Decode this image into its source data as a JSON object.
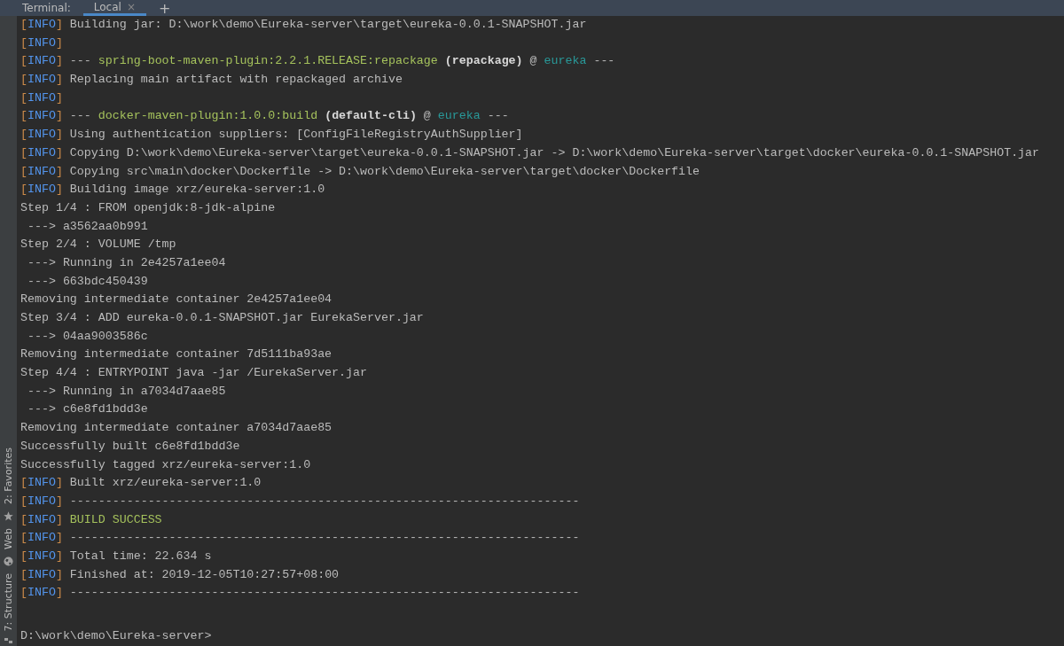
{
  "tool_window": {
    "title": "Terminal:",
    "tabs": [
      {
        "label": "Local",
        "close": "×",
        "selected": true
      }
    ],
    "add": "+"
  },
  "sidebar": {
    "items": [
      {
        "label": "2: Favorites",
        "kind": "star"
      },
      {
        "label": "Web",
        "kind": "globe"
      },
      {
        "label": "7: Structure",
        "kind": "structure"
      }
    ]
  },
  "console": {
    "lines": [
      {
        "segments": [
          {
            "kind": "bracket",
            "text": "["
          },
          {
            "kind": "level",
            "text": "INFO"
          },
          {
            "kind": "bracket",
            "text": "]"
          },
          {
            "kind": "plain",
            "text": " Building jar: D:\\work\\demo\\Eureka-server\\target\\eureka-0.0.1-SNAPSHOT.jar"
          }
        ]
      },
      {
        "segments": [
          {
            "kind": "bracket",
            "text": "["
          },
          {
            "kind": "level",
            "text": "INFO"
          },
          {
            "kind": "bracket",
            "text": "]"
          }
        ]
      },
      {
        "segments": [
          {
            "kind": "bracket",
            "text": "["
          },
          {
            "kind": "level",
            "text": "INFO"
          },
          {
            "kind": "bracket",
            "text": "]"
          },
          {
            "kind": "plain",
            "text": " --- "
          },
          {
            "kind": "plugin",
            "text": "spring-boot-maven-plugin:2.2.1.RELEASE:repackage"
          },
          {
            "kind": "bold",
            "text": " (repackage)"
          },
          {
            "kind": "plain",
            "text": " @ "
          },
          {
            "kind": "module",
            "text": "eureka"
          },
          {
            "kind": "plain",
            "text": " ---"
          }
        ]
      },
      {
        "segments": [
          {
            "kind": "bracket",
            "text": "["
          },
          {
            "kind": "level",
            "text": "INFO"
          },
          {
            "kind": "bracket",
            "text": "]"
          },
          {
            "kind": "plain",
            "text": " Replacing main artifact with repackaged archive"
          }
        ]
      },
      {
        "segments": [
          {
            "kind": "bracket",
            "text": "["
          },
          {
            "kind": "level",
            "text": "INFO"
          },
          {
            "kind": "bracket",
            "text": "]"
          }
        ]
      },
      {
        "segments": [
          {
            "kind": "bracket",
            "text": "["
          },
          {
            "kind": "level",
            "text": "INFO"
          },
          {
            "kind": "bracket",
            "text": "]"
          },
          {
            "kind": "plain",
            "text": " --- "
          },
          {
            "kind": "plugin",
            "text": "docker-maven-plugin:1.0.0:build"
          },
          {
            "kind": "bold",
            "text": " (default-cli)"
          },
          {
            "kind": "plain",
            "text": " @ "
          },
          {
            "kind": "module",
            "text": "eureka"
          },
          {
            "kind": "plain",
            "text": " ---"
          }
        ]
      },
      {
        "segments": [
          {
            "kind": "bracket",
            "text": "["
          },
          {
            "kind": "level",
            "text": "INFO"
          },
          {
            "kind": "bracket",
            "text": "]"
          },
          {
            "kind": "plain",
            "text": " Using authentication suppliers: [ConfigFileRegistryAuthSupplier]"
          }
        ]
      },
      {
        "segments": [
          {
            "kind": "bracket",
            "text": "["
          },
          {
            "kind": "level",
            "text": "INFO"
          },
          {
            "kind": "bracket",
            "text": "]"
          },
          {
            "kind": "plain",
            "text": " Copying D:\\work\\demo\\Eureka-server\\target\\eureka-0.0.1-SNAPSHOT.jar -> D:\\work\\demo\\Eureka-server\\target\\docker\\eureka-0.0.1-SNAPSHOT.jar"
          }
        ]
      },
      {
        "segments": [
          {
            "kind": "bracket",
            "text": "["
          },
          {
            "kind": "level",
            "text": "INFO"
          },
          {
            "kind": "bracket",
            "text": "]"
          },
          {
            "kind": "plain",
            "text": " Copying src\\main\\docker\\Dockerfile -> D:\\work\\demo\\Eureka-server\\target\\docker\\Dockerfile"
          }
        ]
      },
      {
        "segments": [
          {
            "kind": "bracket",
            "text": "["
          },
          {
            "kind": "level",
            "text": "INFO"
          },
          {
            "kind": "bracket",
            "text": "]"
          },
          {
            "kind": "plain",
            "text": " Building image xrz/eureka-server:1.0"
          }
        ]
      },
      {
        "segments": [
          {
            "kind": "plain",
            "text": "Step 1/4 : FROM openjdk:8-jdk-alpine"
          }
        ]
      },
      {
        "segments": [
          {
            "kind": "plain",
            "text": " ---> a3562aa0b991"
          }
        ]
      },
      {
        "segments": [
          {
            "kind": "plain",
            "text": "Step 2/4 : VOLUME /tmp"
          }
        ]
      },
      {
        "segments": [
          {
            "kind": "plain",
            "text": " ---> Running in 2e4257a1ee04"
          }
        ]
      },
      {
        "segments": [
          {
            "kind": "plain",
            "text": " ---> 663bdc450439"
          }
        ]
      },
      {
        "segments": [
          {
            "kind": "plain",
            "text": "Removing intermediate container 2e4257a1ee04"
          }
        ]
      },
      {
        "segments": [
          {
            "kind": "plain",
            "text": "Step 3/4 : ADD eureka-0.0.1-SNAPSHOT.jar EurekaServer.jar"
          }
        ]
      },
      {
        "segments": [
          {
            "kind": "plain",
            "text": " ---> 04aa9003586c"
          }
        ]
      },
      {
        "segments": [
          {
            "kind": "plain",
            "text": "Removing intermediate container 7d5111ba93ae"
          }
        ]
      },
      {
        "segments": [
          {
            "kind": "plain",
            "text": "Step 4/4 : ENTRYPOINT java -jar /EurekaServer.jar"
          }
        ]
      },
      {
        "segments": [
          {
            "kind": "plain",
            "text": " ---> Running in a7034d7aae85"
          }
        ]
      },
      {
        "segments": [
          {
            "kind": "plain",
            "text": " ---> c6e8fd1bdd3e"
          }
        ]
      },
      {
        "segments": [
          {
            "kind": "plain",
            "text": "Removing intermediate container a7034d7aae85"
          }
        ]
      },
      {
        "segments": [
          {
            "kind": "plain",
            "text": "Successfully built c6e8fd1bdd3e"
          }
        ]
      },
      {
        "segments": [
          {
            "kind": "plain",
            "text": "Successfully tagged xrz/eureka-server:1.0"
          }
        ]
      },
      {
        "segments": [
          {
            "kind": "bracket",
            "text": "["
          },
          {
            "kind": "level",
            "text": "INFO"
          },
          {
            "kind": "bracket",
            "text": "]"
          },
          {
            "kind": "plain",
            "text": " Built xrz/eureka-server:1.0"
          }
        ]
      },
      {
        "segments": [
          {
            "kind": "bracket",
            "text": "["
          },
          {
            "kind": "level",
            "text": "INFO"
          },
          {
            "kind": "bracket",
            "text": "]"
          },
          {
            "kind": "plain",
            "text": " ------------------------------------------------------------------------"
          }
        ]
      },
      {
        "segments": [
          {
            "kind": "bracket",
            "text": "["
          },
          {
            "kind": "level",
            "text": "INFO"
          },
          {
            "kind": "bracket",
            "text": "]"
          },
          {
            "kind": "success",
            "text": " BUILD SUCCESS"
          }
        ]
      },
      {
        "segments": [
          {
            "kind": "bracket",
            "text": "["
          },
          {
            "kind": "level",
            "text": "INFO"
          },
          {
            "kind": "bracket",
            "text": "]"
          },
          {
            "kind": "plain",
            "text": " ------------------------------------------------------------------------"
          }
        ]
      },
      {
        "segments": [
          {
            "kind": "bracket",
            "text": "["
          },
          {
            "kind": "level",
            "text": "INFO"
          },
          {
            "kind": "bracket",
            "text": "]"
          },
          {
            "kind": "plain",
            "text": " Total time: 22.634 s"
          }
        ]
      },
      {
        "segments": [
          {
            "kind": "bracket",
            "text": "["
          },
          {
            "kind": "level",
            "text": "INFO"
          },
          {
            "kind": "bracket",
            "text": "]"
          },
          {
            "kind": "plain",
            "text": " Finished at: 2019-12-05T10:27:57+08:00"
          }
        ]
      },
      {
        "segments": [
          {
            "kind": "bracket",
            "text": "["
          },
          {
            "kind": "level",
            "text": "INFO"
          },
          {
            "kind": "bracket",
            "text": "]"
          },
          {
            "kind": "plain",
            "text": " ------------------------------------------------------------------------"
          }
        ]
      }
    ],
    "prompt": "D:\\work\\demo\\Eureka-server>"
  }
}
